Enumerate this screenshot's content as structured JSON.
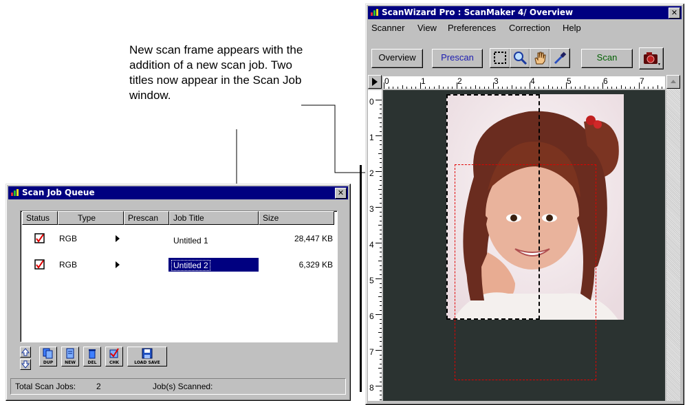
{
  "annotation": {
    "text": "New scan frame appears with the addition of a new scan job. Two  titles now appear in the Scan Job window."
  },
  "scanwizard": {
    "title": "ScanWizard Pro : ScanMaker 4/ Overview",
    "close": "✕",
    "menu": [
      "Scanner",
      "View",
      "Preferences",
      "Correction",
      "Help"
    ],
    "toolbar": {
      "overview": "Overview",
      "prescan": "Prescan",
      "scan": "Scan"
    },
    "ruler_h": [
      "0",
      "1",
      "2",
      "3",
      "4",
      "5",
      "6",
      "7"
    ],
    "ruler_v": [
      "0",
      "1",
      "2",
      "3",
      "4",
      "5",
      "6",
      "7",
      "8"
    ]
  },
  "queue": {
    "title": "Scan Job Queue",
    "close": "✕",
    "columns": [
      "Status",
      "Type",
      "Prescan",
      "Job Title",
      "Size"
    ],
    "rows": [
      {
        "type": "RGB",
        "title": "Untitled 1",
        "size": "28,447 KB"
      },
      {
        "type": "RGB",
        "title": "Untitled 2",
        "size": "6,329 KB"
      }
    ],
    "buttons": {
      "dup": "DUP",
      "new": "NEW",
      "del": "DEL",
      "chk": "CHK",
      "loadsave": "LOAD SAVE"
    },
    "status": {
      "total_label": "Total Scan Jobs:",
      "total_value": "2",
      "scanned_label": "Job(s) Scanned:"
    }
  },
  "colors": {
    "titlebar": "#000080",
    "frame_red": "#e00000",
    "canvas": "#2b3331"
  }
}
